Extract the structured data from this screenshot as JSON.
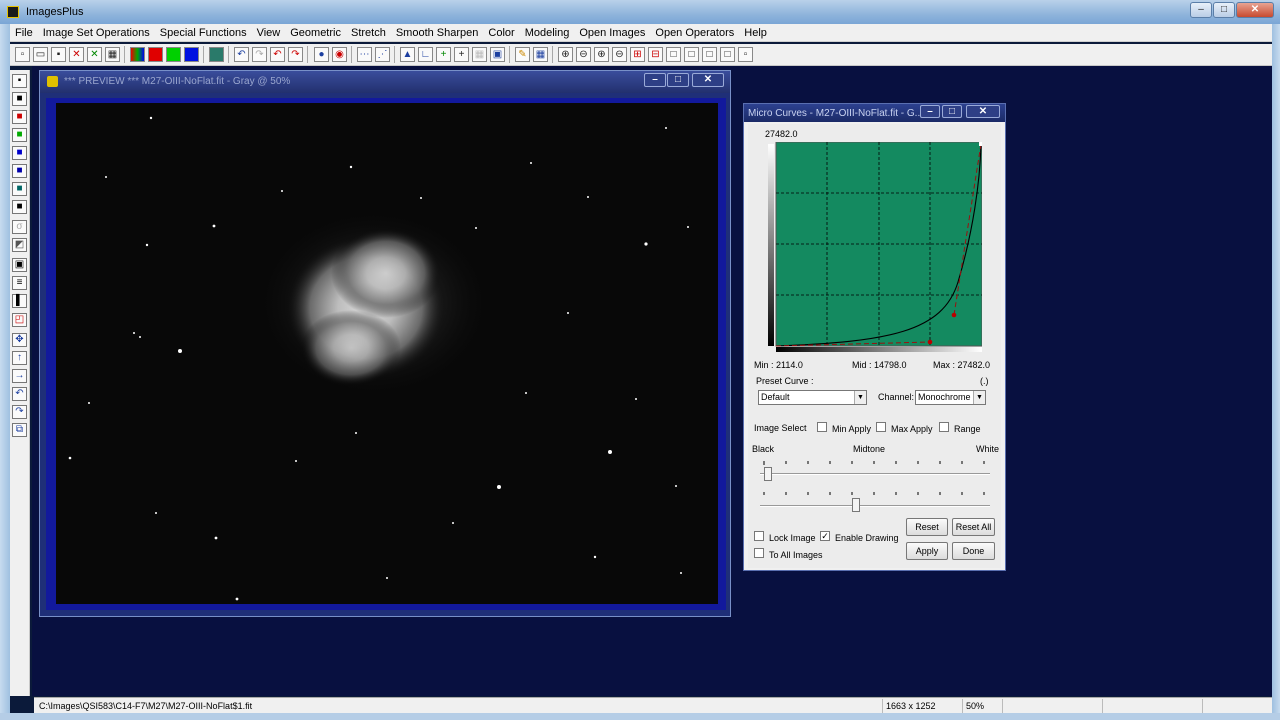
{
  "app": {
    "title": "ImagesPlus"
  },
  "menu": [
    "File",
    "Image Set Operations",
    "Special Functions",
    "View",
    "Geometric",
    "Stretch",
    "Smooth Sharpen",
    "Color",
    "Modeling",
    "Open Images",
    "Open Operators",
    "Help"
  ],
  "preview": {
    "title": "*** PREVIEW *** M27-OIII-NoFlat.fit - Gray @ 50%"
  },
  "curves": {
    "title": "Micro Curves - M27-OIII-NoFlat.fit - G...",
    "max_label": "27482.0",
    "min_text": "Min : 2114.0",
    "mid_text": "Mid : 14798.0",
    "max_text": "Max : 27482.0",
    "preset_label": "Preset Curve :",
    "preset_hint": "(.)",
    "preset_value": "Default",
    "channel_label": "Channel:",
    "channel_value": "Monochrome",
    "image_select_label": "Image Select",
    "min_apply": "Min Apply",
    "max_apply": "Max Apply",
    "range": "Range",
    "black": "Black",
    "midtone": "Midtone",
    "white": "White",
    "lock_image": "Lock Image",
    "enable_drawing": "Enable Drawing",
    "to_all_images": "To All Images",
    "reset": "Reset",
    "reset_all": "Reset All",
    "apply": "Apply",
    "done": "Done",
    "plot_color": "#148a60"
  },
  "status": {
    "path": "C:\\Images\\QSI583\\C14-F7\\M27\\M27-OIII-NoFlat$1.fit",
    "dimensions": "1663 x 1252",
    "zoom": "50%"
  }
}
